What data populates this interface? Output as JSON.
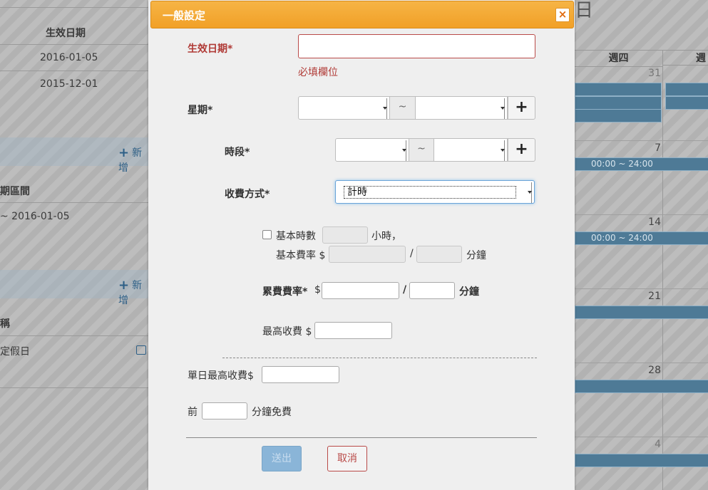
{
  "background": {
    "left_panel": {
      "col_header": "生效日期",
      "rows": [
        "2016-01-05",
        "2015-12-01"
      ],
      "add_label_1": "新增",
      "section_label_2": "期區間",
      "row_2": "~ 2016-01-05",
      "add_label_2": "新增",
      "section_label_3": "稱",
      "row_3": "定假日"
    },
    "calendar": {
      "title_fragment": "日",
      "day_headers": [
        "週四",
        "週"
      ],
      "dates": [
        "31",
        "7",
        "14",
        "21",
        "28",
        "4"
      ],
      "events": [
        "00:00 ~ 24:00",
        "00:00 ~ 24:00"
      ]
    }
  },
  "modal": {
    "title": "一般設定",
    "close_symbol": "×",
    "effective_date": {
      "label": "生效日期*",
      "value": "",
      "error": "必填欄位"
    },
    "weekday": {
      "label": "星期*",
      "separator": "~",
      "add": "+"
    },
    "period": {
      "label": "時段*",
      "separator": "~",
      "add": "+"
    },
    "charge_method": {
      "label": "收費方式*",
      "value": "計時"
    },
    "basic": {
      "hours_label": "基本時數",
      "hours_unit": "小時，",
      "rate_label": "基本費率 $",
      "slash": "/",
      "minute_unit": "分鐘"
    },
    "cumulative": {
      "label": "累費費率*",
      "dollar": "$",
      "slash": "/",
      "minute_unit": "分鐘"
    },
    "max_fee": {
      "label": "最高收費 $"
    },
    "daily_max": {
      "label": "單日最高收費$"
    },
    "free_minutes": {
      "prefix": "前",
      "suffix": "分鐘免費"
    },
    "buttons": {
      "submit": "送出",
      "cancel": "取消"
    }
  },
  "colors": {
    "header_orange": "#f1a027",
    "error_red": "#b03a36",
    "submit_blue": "#8ab5d8",
    "event_blue": "#4e7a96"
  }
}
